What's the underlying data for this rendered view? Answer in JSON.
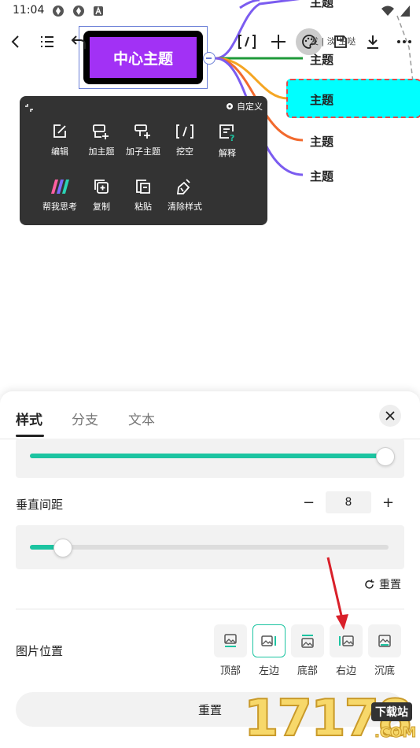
{
  "status_bar": {
    "time": "11:04"
  },
  "toolbar": {
    "partial_text": "发 | 淡 生哒"
  },
  "mindmap": {
    "central_topic": "中心主题",
    "branches": [
      {
        "label": "主题",
        "color": "#7b5cf0"
      },
      {
        "label": "主题",
        "color": "#1f9a3a"
      },
      {
        "label": "主题",
        "color": "#f5a623"
      },
      {
        "label": "主题",
        "color": "#f26a2e"
      },
      {
        "label": "主题",
        "color": "#7b5cf0"
      }
    ]
  },
  "context_menu": {
    "custom_label": "自定义",
    "items": [
      {
        "label": "编辑",
        "icon": "edit-icon"
      },
      {
        "label": "加主题",
        "icon": "add-topic-icon"
      },
      {
        "label": "加子主题",
        "icon": "add-subtopic-icon"
      },
      {
        "label": "挖空",
        "icon": "blank-icon"
      },
      {
        "label": "解释",
        "icon": "explain-icon"
      },
      {
        "label": "帮我思考",
        "icon": "ai-think-icon"
      },
      {
        "label": "复制",
        "icon": "copy-icon"
      },
      {
        "label": "粘贴",
        "icon": "paste-icon"
      },
      {
        "label": "清除样式",
        "icon": "clear-style-icon"
      }
    ]
  },
  "style_panel": {
    "tabs": [
      {
        "label": "样式",
        "active": true
      },
      {
        "label": "分支",
        "active": false
      },
      {
        "label": "文本",
        "active": false
      }
    ],
    "top_slider_value": 0.99,
    "vertical_spacing": {
      "label": "垂直间距",
      "minus": "−",
      "plus": "+",
      "value": "8",
      "slider_value": 0.09
    },
    "reset_label": "重置",
    "image_position": {
      "label": "图片位置",
      "options": [
        {
          "label": "顶部",
          "selected": false
        },
        {
          "label": "左边",
          "selected": true
        },
        {
          "label": "底部",
          "selected": false
        },
        {
          "label": "右边",
          "selected": false
        },
        {
          "label": "沉底",
          "selected": false
        }
      ]
    },
    "reset_all_label": "重置"
  },
  "colors": {
    "accent": "#1cc4a1",
    "central_fill": "#a231f5",
    "selected_node": "#00ffff",
    "annotation_arrow": "#d9202a"
  },
  "watermark": {
    "text": "17178",
    "sub": "下载站",
    "domain": ".COM"
  }
}
